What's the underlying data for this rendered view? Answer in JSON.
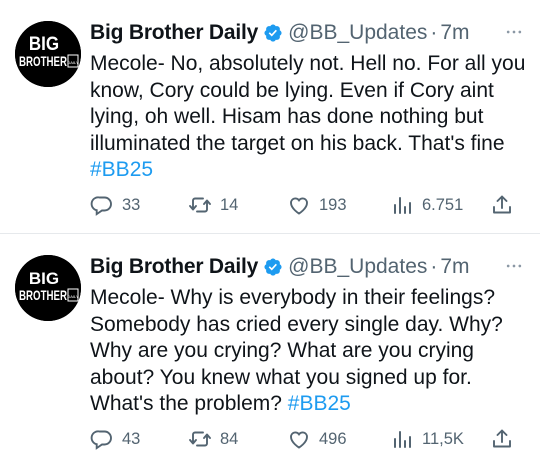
{
  "tweets": [
    {
      "author": "Big Brother Daily",
      "handle": "@BB_Updates",
      "separator": "·",
      "time": "7m",
      "text": "Mecole- No, absolutely not. Hell no. For all you know, Cory could be lying. Even if Cory aint lying, oh well. Hisam has done nothing but illuminated the target on his back. That's fine ",
      "hashtag": "#BB25",
      "replies": "33",
      "reposts": "14",
      "likes": "193",
      "views": "6.751"
    },
    {
      "author": "Big Brother Daily",
      "handle": "@BB_Updates",
      "separator": "·",
      "time": "7m",
      "text": "Mecole- Why is everybody in their feelings? Somebody has cried every single day. Why? Why are you crying? What are you crying about? You knew what you signed up for. What's the problem? ",
      "hashtag": "#BB25",
      "replies": "43",
      "reposts": "84",
      "likes": "496",
      "views": "11,5K"
    }
  ],
  "avatar_logo": {
    "line1": "BIG",
    "line2": "BROTHER",
    "tag": "DAILY"
  },
  "colors": {
    "accent": "#1d9bf0",
    "muted": "#536471",
    "text": "#0f1419",
    "divider": "#e6e9ec"
  },
  "icons": [
    "verified-badge-icon",
    "more-icon",
    "reply-icon",
    "repost-icon",
    "like-icon",
    "views-icon",
    "share-icon"
  ]
}
